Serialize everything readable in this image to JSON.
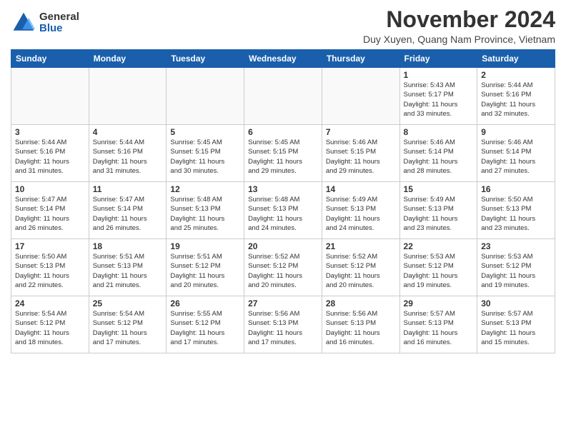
{
  "logo": {
    "general": "General",
    "blue": "Blue"
  },
  "title": "November 2024",
  "location": "Duy Xuyen, Quang Nam Province, Vietnam",
  "headers": [
    "Sunday",
    "Monday",
    "Tuesday",
    "Wednesday",
    "Thursday",
    "Friday",
    "Saturday"
  ],
  "weeks": [
    [
      {
        "day": "",
        "info": ""
      },
      {
        "day": "",
        "info": ""
      },
      {
        "day": "",
        "info": ""
      },
      {
        "day": "",
        "info": ""
      },
      {
        "day": "",
        "info": ""
      },
      {
        "day": "1",
        "info": "Sunrise: 5:43 AM\nSunset: 5:17 PM\nDaylight: 11 hours\nand 33 minutes."
      },
      {
        "day": "2",
        "info": "Sunrise: 5:44 AM\nSunset: 5:16 PM\nDaylight: 11 hours\nand 32 minutes."
      }
    ],
    [
      {
        "day": "3",
        "info": "Sunrise: 5:44 AM\nSunset: 5:16 PM\nDaylight: 11 hours\nand 31 minutes."
      },
      {
        "day": "4",
        "info": "Sunrise: 5:44 AM\nSunset: 5:16 PM\nDaylight: 11 hours\nand 31 minutes."
      },
      {
        "day": "5",
        "info": "Sunrise: 5:45 AM\nSunset: 5:15 PM\nDaylight: 11 hours\nand 30 minutes."
      },
      {
        "day": "6",
        "info": "Sunrise: 5:45 AM\nSunset: 5:15 PM\nDaylight: 11 hours\nand 29 minutes."
      },
      {
        "day": "7",
        "info": "Sunrise: 5:46 AM\nSunset: 5:15 PM\nDaylight: 11 hours\nand 29 minutes."
      },
      {
        "day": "8",
        "info": "Sunrise: 5:46 AM\nSunset: 5:14 PM\nDaylight: 11 hours\nand 28 minutes."
      },
      {
        "day": "9",
        "info": "Sunrise: 5:46 AM\nSunset: 5:14 PM\nDaylight: 11 hours\nand 27 minutes."
      }
    ],
    [
      {
        "day": "10",
        "info": "Sunrise: 5:47 AM\nSunset: 5:14 PM\nDaylight: 11 hours\nand 26 minutes."
      },
      {
        "day": "11",
        "info": "Sunrise: 5:47 AM\nSunset: 5:14 PM\nDaylight: 11 hours\nand 26 minutes."
      },
      {
        "day": "12",
        "info": "Sunrise: 5:48 AM\nSunset: 5:13 PM\nDaylight: 11 hours\nand 25 minutes."
      },
      {
        "day": "13",
        "info": "Sunrise: 5:48 AM\nSunset: 5:13 PM\nDaylight: 11 hours\nand 24 minutes."
      },
      {
        "day": "14",
        "info": "Sunrise: 5:49 AM\nSunset: 5:13 PM\nDaylight: 11 hours\nand 24 minutes."
      },
      {
        "day": "15",
        "info": "Sunrise: 5:49 AM\nSunset: 5:13 PM\nDaylight: 11 hours\nand 23 minutes."
      },
      {
        "day": "16",
        "info": "Sunrise: 5:50 AM\nSunset: 5:13 PM\nDaylight: 11 hours\nand 23 minutes."
      }
    ],
    [
      {
        "day": "17",
        "info": "Sunrise: 5:50 AM\nSunset: 5:13 PM\nDaylight: 11 hours\nand 22 minutes."
      },
      {
        "day": "18",
        "info": "Sunrise: 5:51 AM\nSunset: 5:13 PM\nDaylight: 11 hours\nand 21 minutes."
      },
      {
        "day": "19",
        "info": "Sunrise: 5:51 AM\nSunset: 5:12 PM\nDaylight: 11 hours\nand 20 minutes."
      },
      {
        "day": "20",
        "info": "Sunrise: 5:52 AM\nSunset: 5:12 PM\nDaylight: 11 hours\nand 20 minutes."
      },
      {
        "day": "21",
        "info": "Sunrise: 5:52 AM\nSunset: 5:12 PM\nDaylight: 11 hours\nand 20 minutes."
      },
      {
        "day": "22",
        "info": "Sunrise: 5:53 AM\nSunset: 5:12 PM\nDaylight: 11 hours\nand 19 minutes."
      },
      {
        "day": "23",
        "info": "Sunrise: 5:53 AM\nSunset: 5:12 PM\nDaylight: 11 hours\nand 19 minutes."
      }
    ],
    [
      {
        "day": "24",
        "info": "Sunrise: 5:54 AM\nSunset: 5:12 PM\nDaylight: 11 hours\nand 18 minutes."
      },
      {
        "day": "25",
        "info": "Sunrise: 5:54 AM\nSunset: 5:12 PM\nDaylight: 11 hours\nand 17 minutes."
      },
      {
        "day": "26",
        "info": "Sunrise: 5:55 AM\nSunset: 5:12 PM\nDaylight: 11 hours\nand 17 minutes."
      },
      {
        "day": "27",
        "info": "Sunrise: 5:56 AM\nSunset: 5:13 PM\nDaylight: 11 hours\nand 17 minutes."
      },
      {
        "day": "28",
        "info": "Sunrise: 5:56 AM\nSunset: 5:13 PM\nDaylight: 11 hours\nand 16 minutes."
      },
      {
        "day": "29",
        "info": "Sunrise: 5:57 AM\nSunset: 5:13 PM\nDaylight: 11 hours\nand 16 minutes."
      },
      {
        "day": "30",
        "info": "Sunrise: 5:57 AM\nSunset: 5:13 PM\nDaylight: 11 hours\nand 15 minutes."
      }
    ]
  ]
}
